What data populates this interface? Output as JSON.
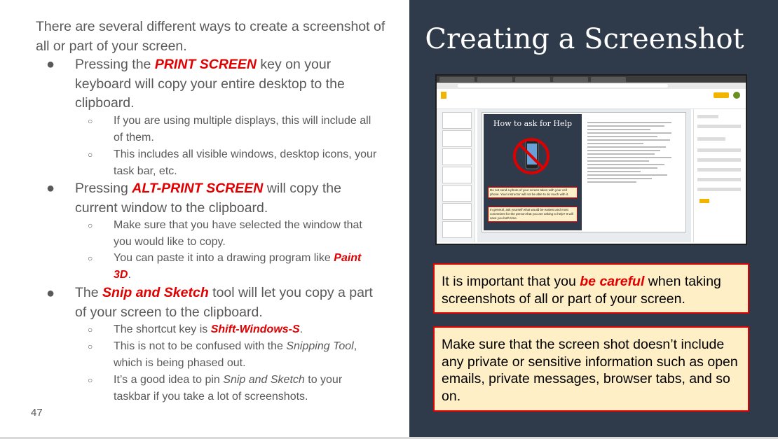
{
  "left": {
    "intro": "There are several different ways to create a screenshot of all or part of your screen.",
    "items": [
      {
        "pre": "Pressing the ",
        "em": "PRINT SCREEN",
        "post": " key on your keyboard will copy your entire desktop to the clipboard.",
        "subs": [
          "If you are using multiple displays, this will include all of them.",
          "This includes all visible windows, desktop icons, your task bar, etc."
        ]
      },
      {
        "pre": "Pressing ",
        "em": "ALT-PRINT SCREEN",
        "post": " will copy the current window to the clipboard.",
        "subs": [
          "Make sure that you have selected the window that you would like to copy.",
          "You can paste it into a drawing program like ",
          "Paint 3D",
          "."
        ]
      },
      {
        "pre": "The ",
        "em": "Snip and Sketch",
        "post": " tool will let you copy a part of your screen to the clipboard.",
        "subs": [
          "The shortcut key is ",
          "Shift-Windows-S",
          ".",
          "This is not to be confused with the ",
          "Snipping Tool",
          ", which is being phased out.",
          "It’s a good idea to pin ",
          "Snip and Sketch",
          " to your taskbar if you take a lot of screenshots."
        ]
      }
    ],
    "bullet": "●",
    "sub_bullet": "○",
    "slide_number": "47"
  },
  "right": {
    "title": "Creating a Screenshot",
    "screenshot": {
      "slide_title": "How to ask for Help",
      "note1": "Do not send a photo of your screen taken with your cell phone. Your instructor will not be able to do much with it.",
      "note2": "In general, ask yourself what would be easiest and most convenient for the person that you are asking to help? It will save you both time."
    },
    "box1": {
      "pre": "It is important that you ",
      "em": "be careful",
      "post": " when taking screenshots of all or part of your screen."
    },
    "box2": {
      "text": "Make sure that the screen shot doesn’t include any private or sensitive information such as open emails, private messages, browser tabs, and so on."
    }
  },
  "colors": {
    "accent_red": "#e00000",
    "panel_bg": "#2f3a4b",
    "box_bg": "#ffefc6",
    "body_text": "#595959"
  }
}
